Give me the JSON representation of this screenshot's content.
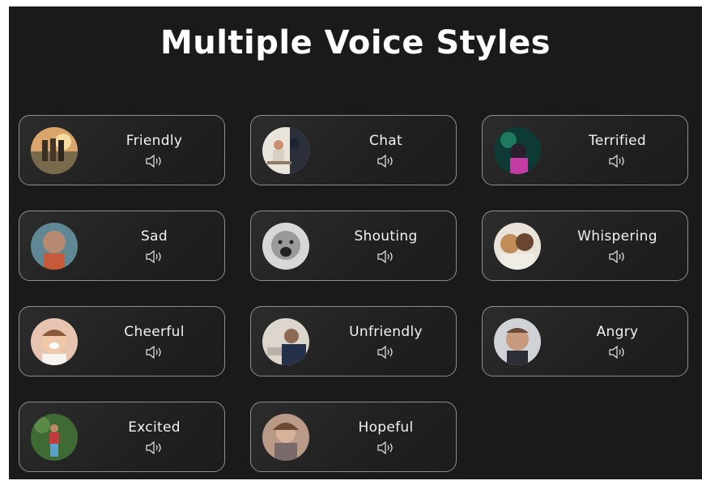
{
  "title": "Multiple Voice Styles",
  "icons": {
    "avatar": "person-photo-icon",
    "play": "speaker-icon"
  },
  "colors": {
    "background": "#1a1a1a",
    "card_border": "#8e8e8e",
    "text": "#ffffff"
  },
  "styles": [
    {
      "label": "Friendly"
    },
    {
      "label": "Chat"
    },
    {
      "label": "Terrified"
    },
    {
      "label": "Sad"
    },
    {
      "label": "Shouting"
    },
    {
      "label": "Whispering"
    },
    {
      "label": "Cheerful"
    },
    {
      "label": "Unfriendly"
    },
    {
      "label": "Angry"
    },
    {
      "label": "Excited"
    },
    {
      "label": "Hopeful"
    }
  ]
}
